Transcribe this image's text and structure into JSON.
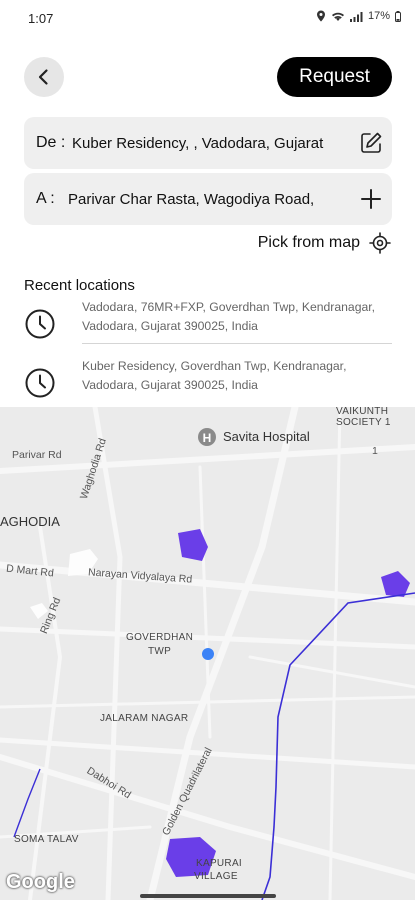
{
  "status_bar": {
    "time": "1:07",
    "battery": "17%"
  },
  "header": {
    "back_icon": "arrow-left-icon",
    "request_label": "Request"
  },
  "from_field": {
    "label": "De :",
    "value": "Kuber Residency, , Vadodara, Gujarat",
    "icon": "edit-icon"
  },
  "to_field": {
    "label": "A :",
    "value": "Parivar Char Rasta, Wagodiya Road,",
    "icon": "plus-icon"
  },
  "pick_from_map": {
    "label": "Pick from map",
    "icon": "locate-icon"
  },
  "recent": {
    "title": "Recent locations",
    "items": [
      {
        "address": "Vadodara, 76MR+FXP, Goverdhan Twp, Kendranagar, Vadodara, Gujarat 390025, India",
        "icon": "clock-icon"
      },
      {
        "address": "Kuber Residency, Goverdhan Twp, Kendranagar, Vadodara, Gujarat 390025, India",
        "icon": "clock-icon"
      }
    ]
  },
  "map": {
    "labels": {
      "savita": "Savita Hospital",
      "vaikunth": "VAIKUNTH",
      "society": "SOCIETY 1",
      "one": "1",
      "parivar_rd": "Parivar Rd",
      "waghodia": "AGHODIA",
      "waghodia_rd": "Waghodia Rd",
      "dmart": "D Mart Rd",
      "narayan": "Narayan Vidyalaya Rd",
      "ring": "Ring Rd",
      "goverdhan": "GOVERDHAN",
      "twp": "TWP",
      "jalaram": "JALARAM NAGAR",
      "dabhoi": "Dabhoi Rd",
      "golden": "Golden Quadrilateral",
      "soma": "SOMA TALAV",
      "kapurai": "KAPURAI",
      "village": "VILLAGE"
    },
    "attribution": "Google",
    "colors": {
      "area_fill": "#6a3ee8",
      "route": "#3b2fd6",
      "location_dot": "#3b82f6",
      "background": "#ebebeb"
    }
  }
}
